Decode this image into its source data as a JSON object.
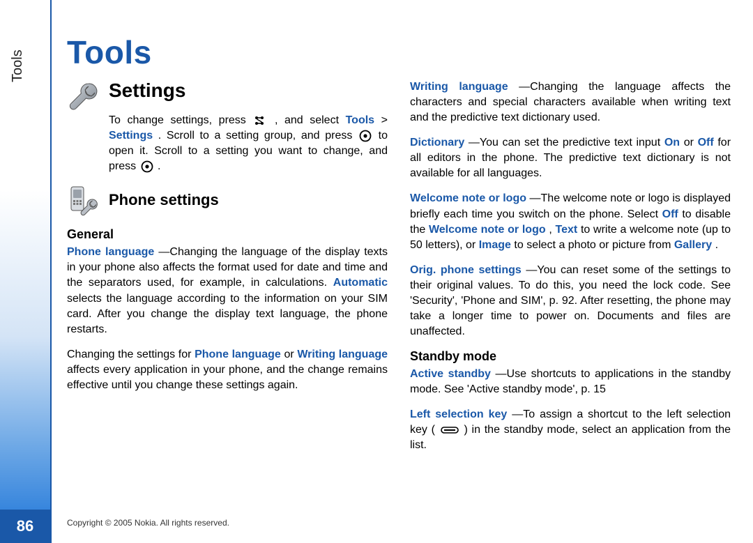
{
  "sidebar": {
    "label": "Tools",
    "page_number": "86"
  },
  "title": "Tools",
  "settings": {
    "heading": "Settings",
    "intro_a": "To change settings, press ",
    "intro_b": " , and select ",
    "path_tools": "Tools",
    "path_sep": " > ",
    "path_settings": "Settings",
    "intro_c": ". Scroll to a setting group, and press ",
    "intro_d": " to open it. Scroll to a setting you want to change, and press ",
    "intro_e": "."
  },
  "phone_settings": {
    "heading": "Phone settings"
  },
  "general": {
    "heading": "General",
    "phone_language": {
      "term": "Phone language",
      "body_a": "—Changing the language of the display texts in your phone also affects the format used for date and time and the separators used, for example, in calculations. ",
      "automatic": "Automatic",
      "body_b": " selects the language according to the information on your SIM card. After you change the display text language, the phone restarts."
    },
    "changing_note": {
      "a": "Changing the settings for ",
      "pl": "Phone language",
      "b": " or ",
      "wl": "Writing language",
      "c": " affects every application in your phone, and the change remains effective until you change these settings again."
    },
    "writing_language": {
      "term": "Writing language",
      "body": "—Changing the language affects the characters and special characters available when writing text and the predictive text dictionary used."
    },
    "dictionary": {
      "term": "Dictionary",
      "a": "—You can set the predictive text input ",
      "on": "On",
      "b": " or ",
      "off": "Off",
      "c": " for all editors in the phone. The predictive text dictionary is not available for all languages."
    },
    "welcome": {
      "term": "Welcome note or logo",
      "a": "—The welcome note or logo is displayed briefly each time you switch on the phone. Select ",
      "off": "Off",
      "b": " to disable the ",
      "wnol": "Welcome note or logo",
      "c": ", ",
      "text": "Text",
      "d": " to write a welcome note (up to 50 letters), or ",
      "image": "Image",
      "e": " to select a photo or picture from ",
      "gallery": "Gallery",
      "f": "."
    },
    "orig": {
      "term": "Orig. phone settings",
      "body": "—You can reset some of the settings to their original values. To do this, you need the lock code. See 'Security', 'Phone and SIM', p. 92. After resetting, the phone may take a longer time to power on. Documents and files are unaffected."
    }
  },
  "standby": {
    "heading": "Standby mode",
    "active": {
      "term": "Active standby",
      "body": "—Use shortcuts to applications in the standby mode. See 'Active standby mode', p. 15"
    },
    "left_key": {
      "term": "Left selection key",
      "a": "—To assign a shortcut to the left selection key (",
      "b": ") in the standby mode, select an application from the list."
    }
  },
  "footer": "Copyright © 2005 Nokia. All rights reserved."
}
